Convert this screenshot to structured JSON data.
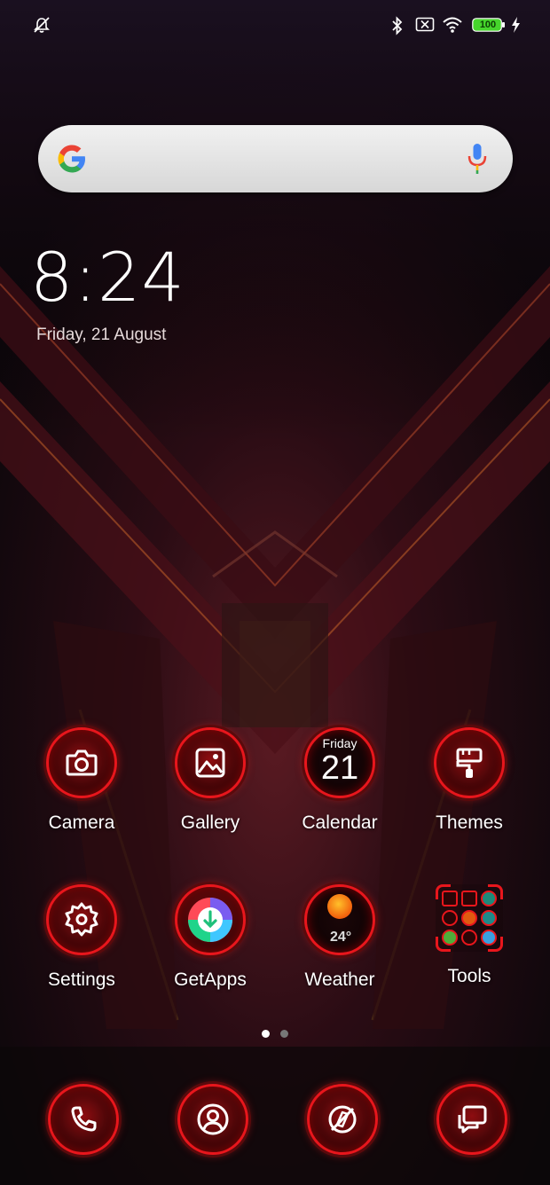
{
  "status_bar": {
    "icons": [
      "notifications-off-icon",
      "bluetooth-icon",
      "no-sim-icon",
      "wifi-icon",
      "battery-icon",
      "charging-icon"
    ],
    "battery_level": "100"
  },
  "search_bar": {
    "logo": "google-logo",
    "mic_icon": "mic-icon"
  },
  "clock": {
    "time": "8:24",
    "date": "Friday, 21 August"
  },
  "apps": [
    {
      "label": "Camera",
      "icon": "camera-icon"
    },
    {
      "label": "Gallery",
      "icon": "gallery-icon"
    },
    {
      "label": "Calendar",
      "icon": "calendar-icon",
      "day_name": "Friday",
      "day_number": "21"
    },
    {
      "label": "Themes",
      "icon": "paint-roller-icon"
    },
    {
      "label": "Settings",
      "icon": "gear-icon"
    },
    {
      "label": "GetApps",
      "icon": "getapps-icon"
    },
    {
      "label": "Weather",
      "icon": "sun-icon",
      "temperature": "24"
    },
    {
      "label": "Tools",
      "icon": "folder-icon"
    }
  ],
  "page_indicator": {
    "pages": 2,
    "current": 1
  },
  "dock": [
    {
      "icon": "phone-icon"
    },
    {
      "icon": "contacts-icon"
    },
    {
      "icon": "browser-icon"
    },
    {
      "icon": "messages-icon"
    }
  ],
  "colors": {
    "accent": "#e8161c",
    "background": "#120a0f",
    "search_bar": "#e4e4e4"
  }
}
